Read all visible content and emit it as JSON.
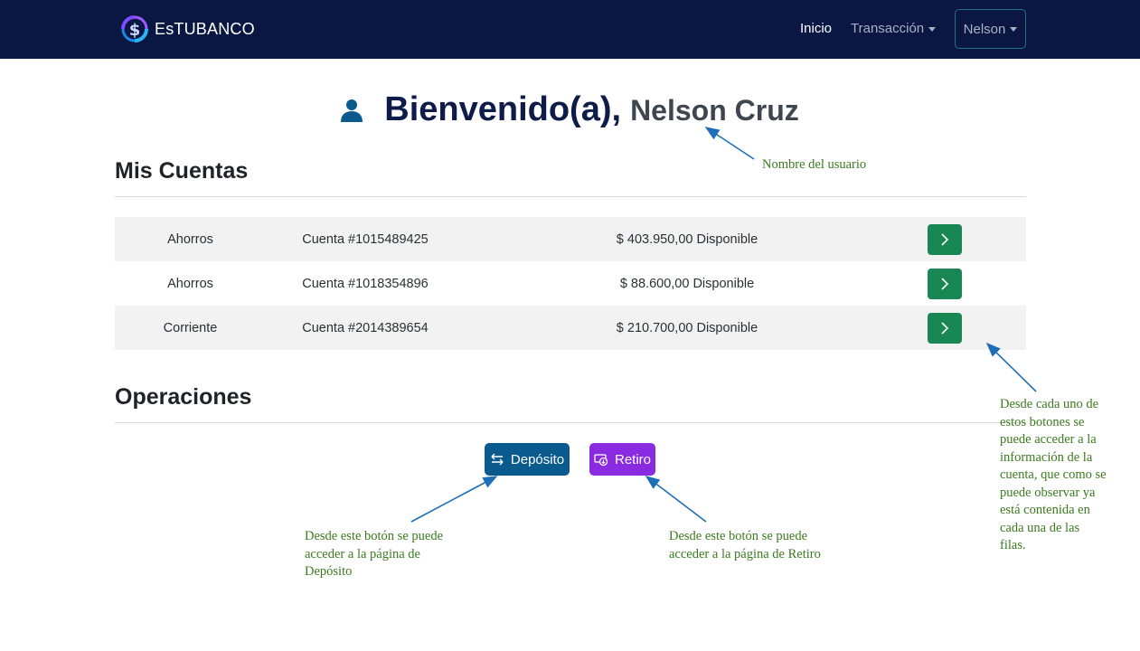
{
  "navbar": {
    "brand": "EsTUBANCO",
    "links": [
      {
        "label": "Inicio",
        "active": true
      },
      {
        "label": "Transacción",
        "dropdown": true
      }
    ],
    "user_menu": "Nelson"
  },
  "welcome": {
    "greeting": "Bienvenido(a),",
    "user_name": "Nelson Cruz",
    "icon": "person-icon"
  },
  "sections": {
    "cuentas_title": "Mis Cuentas",
    "operaciones_title": "Operaciones"
  },
  "accounts": [
    {
      "type": "Ahorros",
      "number": "Cuenta #1015489425",
      "balance": "$ 403.950,00 Disponible"
    },
    {
      "type": "Ahorros",
      "number": "Cuenta #1018354896",
      "balance": "$ 88.600,00 Disponible"
    },
    {
      "type": "Corriente",
      "number": "Cuenta #2014389654",
      "balance": "$ 210.700,00 Disponible"
    }
  ],
  "operations": {
    "deposito_label": "Depósito",
    "retiro_label": "Retiro"
  },
  "annotations": {
    "nombre": "Nombre del usuario",
    "botones": "Desde cada uno de estos botones se puede acceder a la información de la cuenta, que como se puede observar ya está contenida en cada una de las filas.",
    "deposito": "Desde este botón se puede acceder a la página de Depósito",
    "retiro": "Desde este botón se puede acceder a la página de Retiro"
  },
  "colors": {
    "navbar": "#0b1743",
    "go_button": "#198754",
    "deposito_button": "#0b5a8e",
    "retiro_button": "#8a2be2",
    "annotation_text": "#3c7a1e",
    "arrow": "#1f6fb8"
  }
}
